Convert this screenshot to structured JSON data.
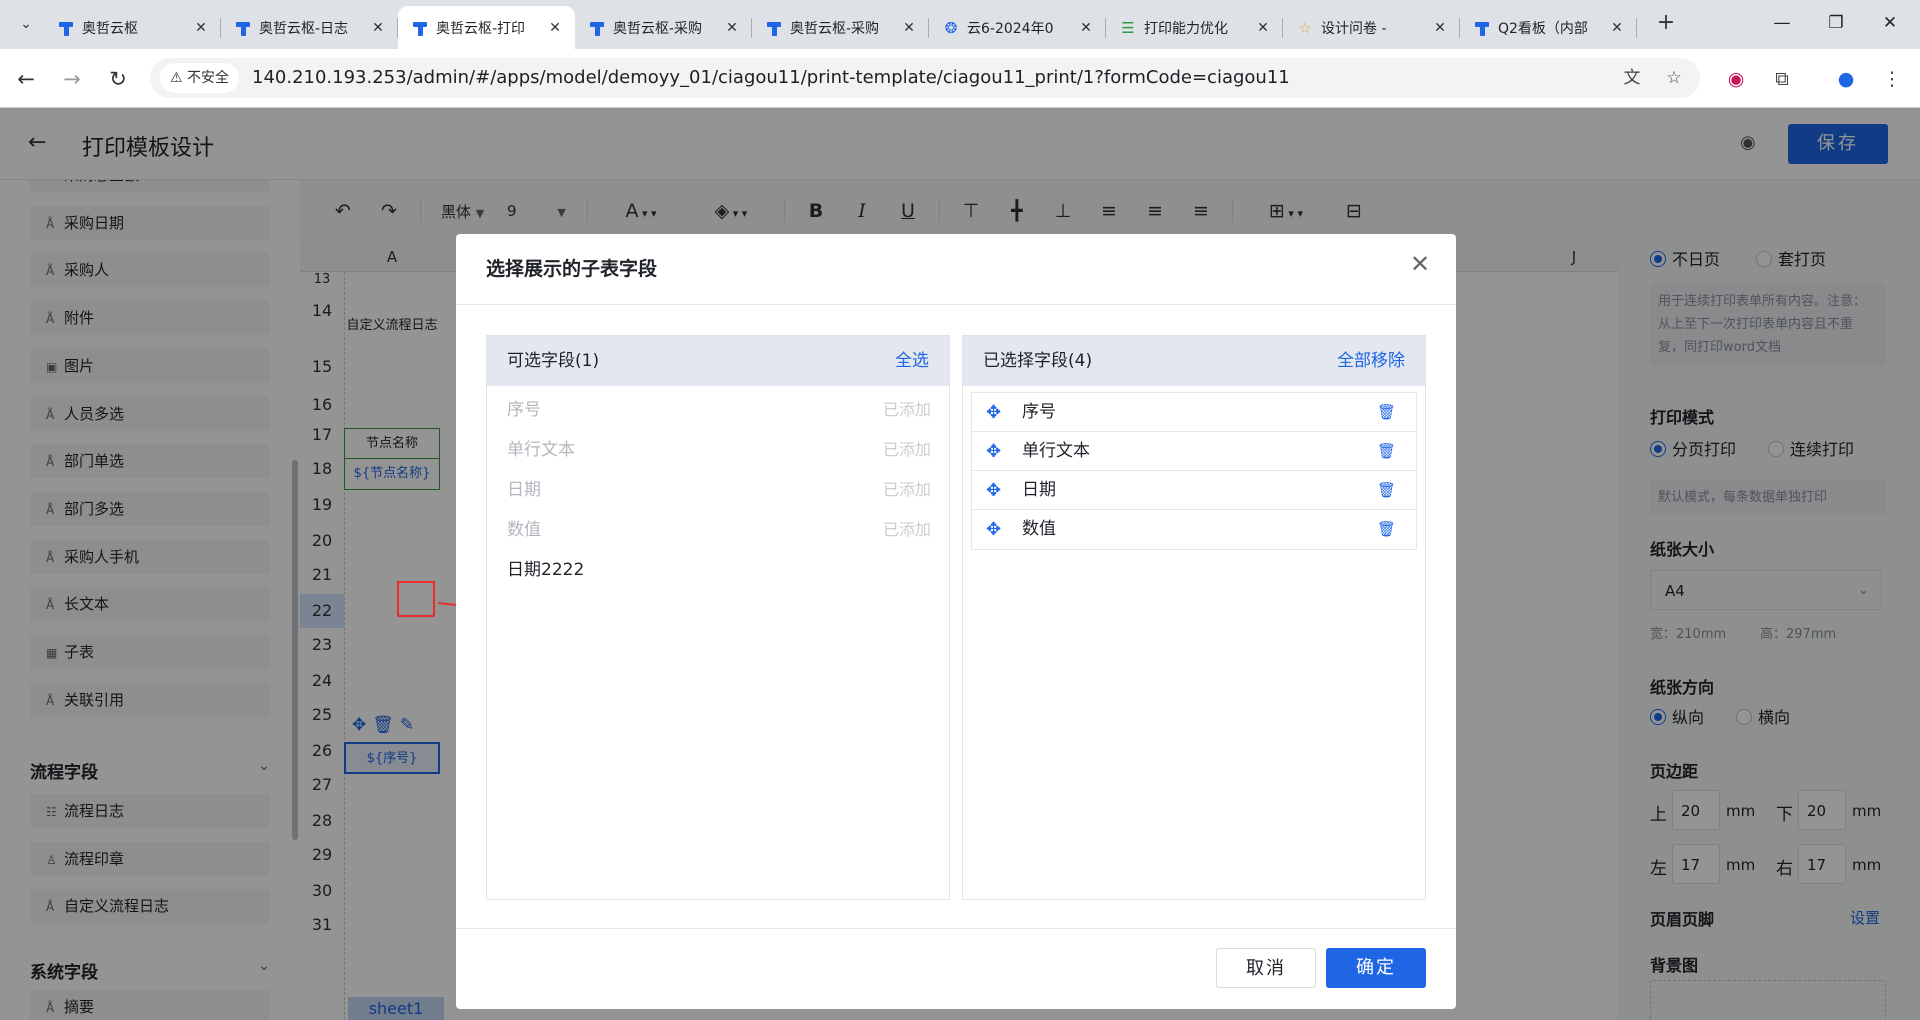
{
  "browser": {
    "tabs": [
      {
        "title": "奥哲云枢",
        "favicon": "logo",
        "active": false
      },
      {
        "title": "奥哲云枢-日志",
        "favicon": "logo",
        "active": false
      },
      {
        "title": "奥哲云枢-打印",
        "favicon": "logo",
        "active": true
      },
      {
        "title": "奥哲云枢-采购",
        "favicon": "logo",
        "active": false
      },
      {
        "title": "奥哲云枢-采购",
        "favicon": "logo",
        "active": false
      },
      {
        "title": "云6-2024年0",
        "favicon": "swirl",
        "active": false
      },
      {
        "title": "打印能力优化",
        "favicon": "doc",
        "active": false
      },
      {
        "title": "设计问卷 - ",
        "favicon": "star",
        "active": false
      },
      {
        "title": "Q2看板（内部",
        "favicon": "logo",
        "active": false
      }
    ],
    "security_label": "不安全",
    "url": "140.210.193.253/admin/#/apps/model/demoyy_01/ciagou11/print-template/ciagou11_print/1?formCode=ciagou11"
  },
  "app": {
    "title": "打印模板设计",
    "save_label": "保存"
  },
  "sidebar": {
    "items": [
      {
        "label": "采购总金额",
        "icon": "text-icon"
      },
      {
        "label": "采购日期",
        "icon": "text-icon"
      },
      {
        "label": "采购人",
        "icon": "text-icon"
      },
      {
        "label": "附件",
        "icon": "text-icon"
      },
      {
        "label": "图片",
        "icon": "image-icon"
      },
      {
        "label": "人员多选",
        "icon": "text-icon"
      },
      {
        "label": "部门单选",
        "icon": "text-icon"
      },
      {
        "label": "部门多选",
        "icon": "text-icon"
      },
      {
        "label": "采购人手机",
        "icon": "text-icon"
      },
      {
        "label": "长文本",
        "icon": "text-icon"
      },
      {
        "label": "子表",
        "icon": "table-icon"
      },
      {
        "label": "关联引用",
        "icon": "text-icon"
      }
    ],
    "group_process": "流程字段",
    "process_items": [
      {
        "label": "流程日志",
        "icon": "list-icon"
      },
      {
        "label": "流程印章",
        "icon": "stamp-icon"
      },
      {
        "label": "自定义流程日志",
        "icon": "text-icon"
      }
    ],
    "group_system": "系统字段",
    "system_items": [
      {
        "label": "摘要",
        "icon": "text-icon"
      }
    ]
  },
  "toolbar": {
    "font": "黑体",
    "size": "9"
  },
  "sheet": {
    "col_a": "A",
    "col_j": "J",
    "rows": [
      "13",
      "14",
      "15",
      "16",
      "17",
      "18",
      "19",
      "20",
      "21",
      "22",
      "23",
      "24",
      "25",
      "26",
      "27",
      "28",
      "29",
      "30",
      "31"
    ],
    "cell_custom_log": "自定义流程日志",
    "cell_node_name": "节点名称",
    "cell_node_var": "${节点名称}",
    "cell_seq_var": "${序号}",
    "sheet_tab": "sheet1"
  },
  "right_panel": {
    "radio_top_a": "不日页",
    "radio_top_b": "套打页",
    "note_continuous": "用于连续打印表单所有内容。注意：从上至下一次打印表单内容且不重复，同打印word文档",
    "print_mode_title": "打印模式",
    "print_mode_a": "分页打印",
    "print_mode_b": "连续打印",
    "print_mode_note": "默认模式，每条数据单独打印",
    "paper_size_title": "纸张大小",
    "paper_size": "A4",
    "paper_width": "宽：210mm",
    "paper_height": "高：297mm",
    "orientation_title": "纸张方向",
    "orientation_a": "纵向",
    "orientation_b": "横向",
    "margin_title": "页边距",
    "margin_top_label": "上",
    "margin_top": "20",
    "margin_bottom_label": "下",
    "margin_bottom": "20",
    "margin_left_label": "左",
    "margin_left": "17",
    "margin_right_label": "右",
    "margin_right": "17",
    "unit": "mm",
    "header_footer_title": "页眉页脚",
    "header_footer_link": "设置",
    "background_title": "背景图"
  },
  "modal": {
    "title": "选择展示的子表字段",
    "available_title": "可选字段(1)",
    "select_all": "全选",
    "available": [
      {
        "label": "序号",
        "status": "已添加",
        "disabled": true
      },
      {
        "label": "单行文本",
        "status": "已添加",
        "disabled": true
      },
      {
        "label": "日期",
        "status": "已添加",
        "disabled": true
      },
      {
        "label": "数值",
        "status": "已添加",
        "disabled": true
      },
      {
        "label": "日期2222",
        "status": "",
        "disabled": false
      }
    ],
    "selected_title": "已选择字段(4)",
    "remove_all": "全部移除",
    "selected": [
      "序号",
      "单行文本",
      "日期",
      "数值"
    ],
    "cancel": "取消",
    "ok": "确定"
  }
}
